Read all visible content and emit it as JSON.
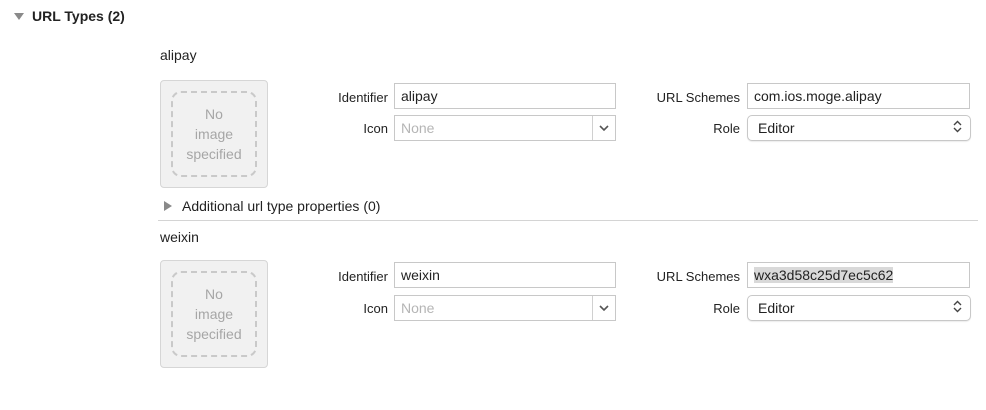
{
  "section": {
    "title": "URL Types (2)"
  },
  "image_placeholder": [
    "No",
    "image",
    "specified"
  ],
  "labels": {
    "identifier": "Identifier",
    "icon": "Icon",
    "url_schemes": "URL Schemes",
    "role": "Role"
  },
  "url_types": [
    {
      "name": "alipay",
      "identifier": "alipay",
      "icon_placeholder": "None",
      "url_schemes": "com.ios.moge.alipay",
      "role": "Editor",
      "additional_properties_label": "Additional url type properties (0)"
    },
    {
      "name": "weixin",
      "identifier": "weixin",
      "icon_placeholder": "None",
      "url_schemes": "wxa3d58c25d7ec5c62",
      "role": "Editor"
    }
  ],
  "colors": {
    "divider": "#d4d4d4",
    "selection_highlight": "#d9d9d9",
    "icon_gray": "#8a8a8a"
  }
}
